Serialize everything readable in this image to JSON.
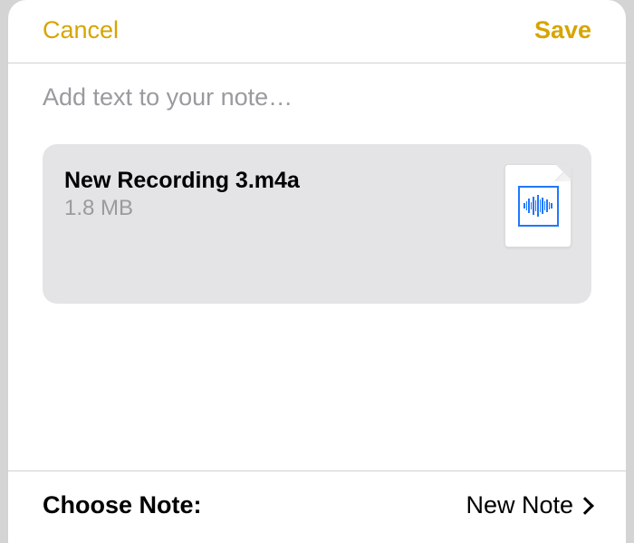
{
  "header": {
    "cancel_label": "Cancel",
    "save_label": "Save"
  },
  "note": {
    "placeholder": "Add text to your note…"
  },
  "attachment": {
    "filename": "New Recording 3.m4a",
    "filesize": "1.8 MB"
  },
  "footer": {
    "label": "Choose Note:",
    "value": "New Note"
  }
}
